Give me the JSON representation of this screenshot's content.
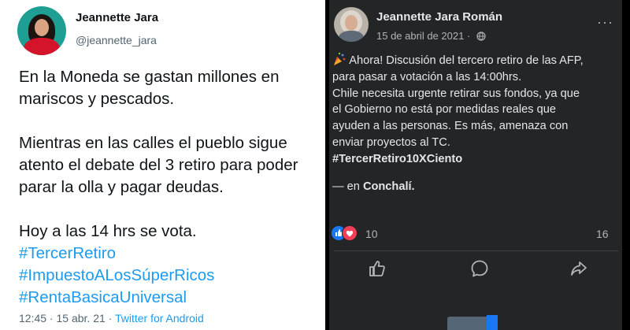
{
  "twitter": {
    "name": "Jeannette Jara",
    "handle": "@jeannette_jara",
    "paragraph1": "En la Moneda se gastan millones en mariscos y pescados.",
    "paragraph2": "Mientras en las calles el pueblo sigue atento el debate del 3 retiro para poder parar la olla y pagar deudas.",
    "paragraph3": "Hoy a las 14 hrs se vota.",
    "hashtags": [
      "#TercerRetiro",
      "#ImpuestoALosSúperRicos",
      "#RentaBasicaUniversal"
    ],
    "time": "12:45",
    "date": "15 abr. 21",
    "source": "Twitter for Android"
  },
  "facebook": {
    "name": "Jeannette Jara Román",
    "date": "15 de abril de 2021 ·",
    "more": "···",
    "lines": [
      "Ahora! Discusión del tercero retiro de las AFP,",
      "para pasar a votación a las 14:00hrs.",
      "Chile necesita urgente retirar sus fondos, ya que",
      "el Gobierno no está por medidas reales que",
      "ayuden a las personas. Es más, amenaza con",
      "enviar proyectos al TC."
    ],
    "hashtag": "#TercerRetiro10XCiento",
    "place_prefix": "— en ",
    "place": "Conchalí.",
    "reactions_count": "10",
    "comments_count": "16",
    "icons": [
      "party-popper-icon",
      "globe-icon",
      "like-icon",
      "comment-icon",
      "share-icon"
    ]
  }
}
